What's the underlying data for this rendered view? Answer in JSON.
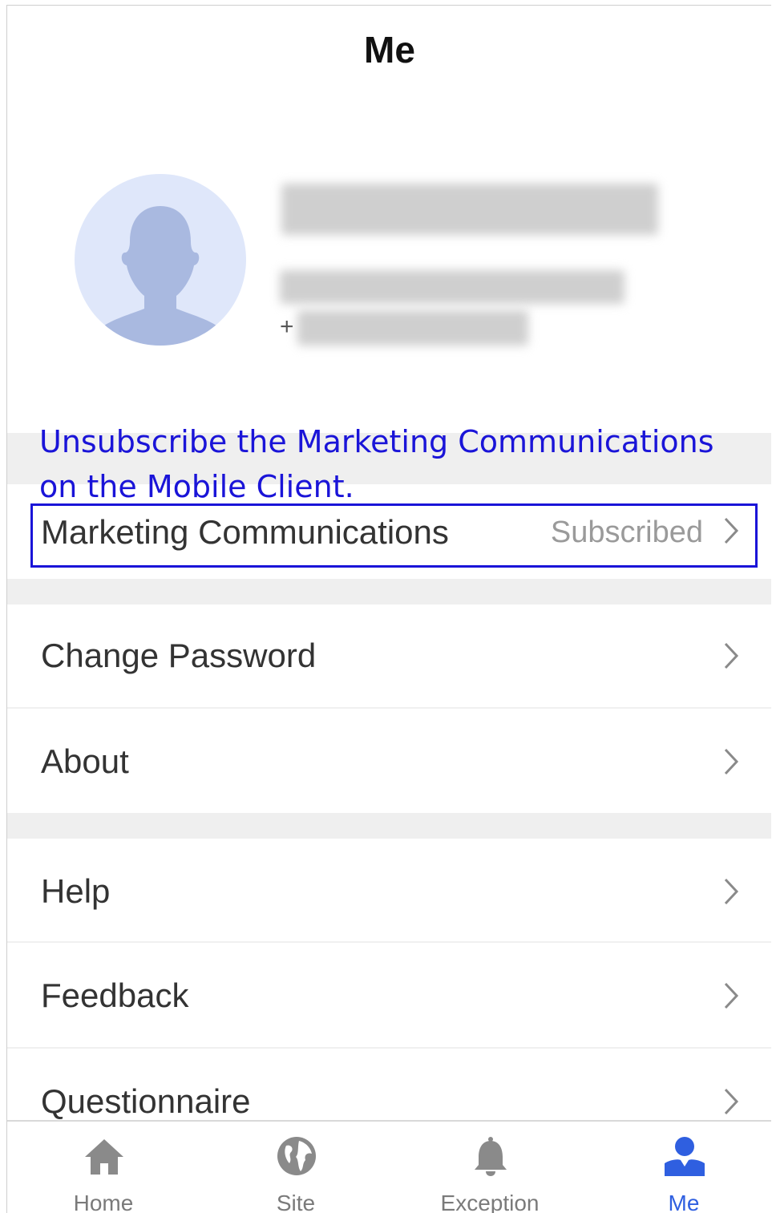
{
  "header": {
    "title": "Me"
  },
  "profile": {
    "phone_prefix": "+"
  },
  "annotation": {
    "text": "Unsubscribe the Marketing Communications on the Mobile Client."
  },
  "menu": {
    "marketing": {
      "label": "Marketing Communications",
      "value": "Subscribed"
    },
    "change_password": {
      "label": "Change Password"
    },
    "about": {
      "label": "About"
    },
    "help": {
      "label": "Help"
    },
    "feedback": {
      "label": "Feedback"
    },
    "questionnaire": {
      "label": "Questionnaire"
    }
  },
  "tabbar": {
    "items": [
      {
        "label": "Home",
        "icon": "home-icon"
      },
      {
        "label": "Site",
        "icon": "globe-icon"
      },
      {
        "label": "Exception Center",
        "icon": "bell-icon"
      },
      {
        "label": "Me",
        "icon": "person-icon"
      }
    ],
    "active": "Me"
  },
  "colors": {
    "accent": "#2f5fe0",
    "annotation": "#1a14d8",
    "section_gap": "#efefef",
    "avatar_bg": "#dfe7fa",
    "avatar_fg": "#a9b9e0"
  }
}
